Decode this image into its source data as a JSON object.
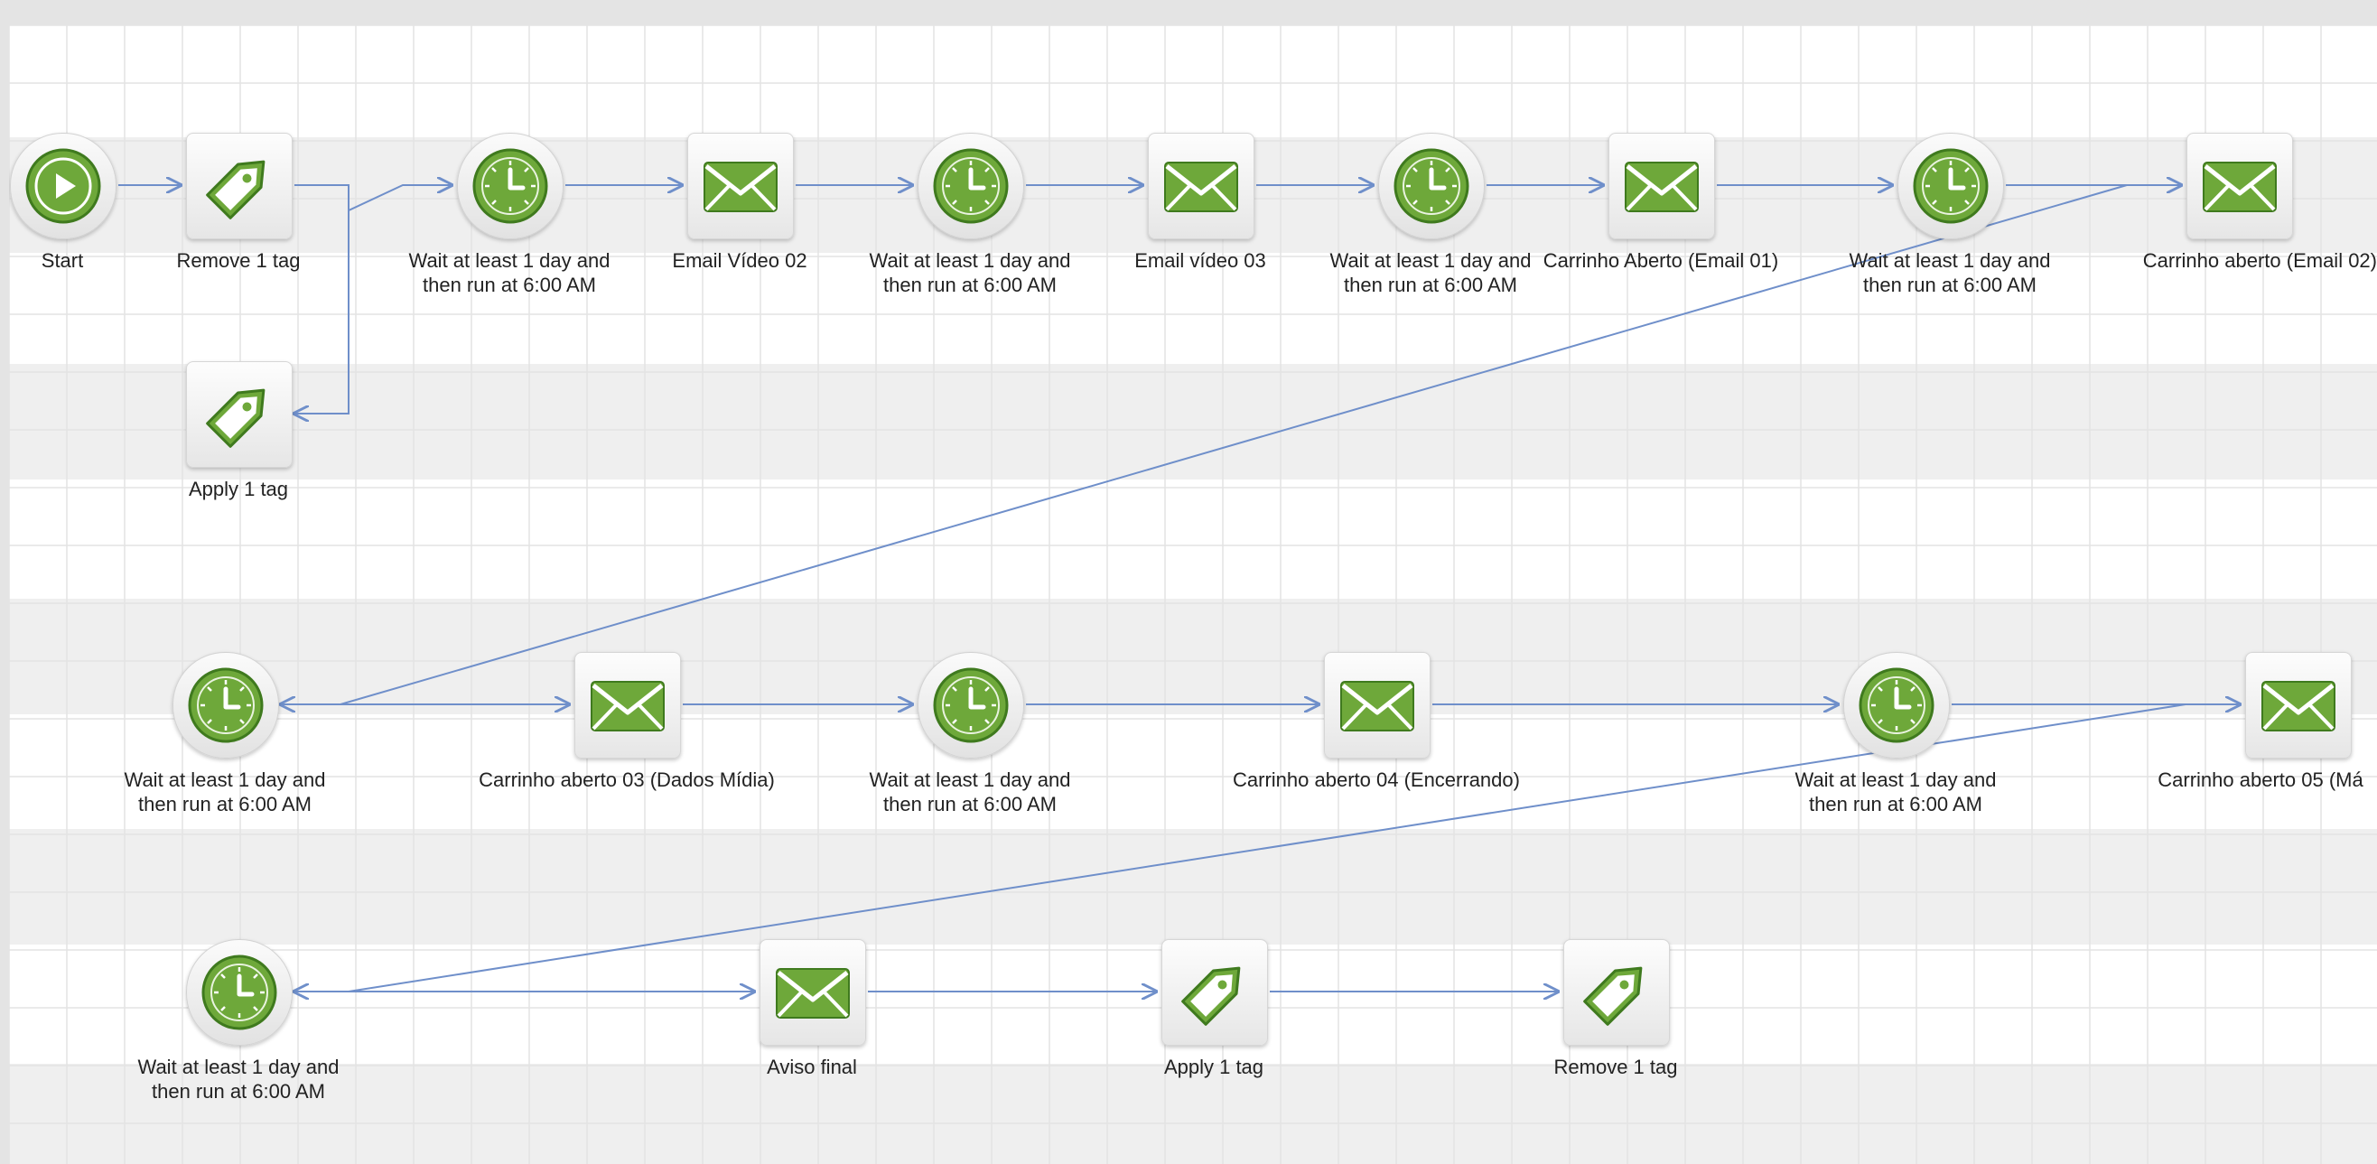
{
  "diagram": {
    "nodes": [
      {
        "id": "start",
        "kind": "start",
        "label": "Start"
      },
      {
        "id": "remove-tag-1",
        "kind": "tag",
        "label": "Remove 1 tag"
      },
      {
        "id": "apply-tag-1",
        "kind": "tag",
        "label": "Apply 1 tag"
      },
      {
        "id": "wait-1",
        "kind": "wait",
        "label": "Wait at least 1 day and\nthen run at 6:00 AM"
      },
      {
        "id": "email-video-02",
        "kind": "email",
        "label": "Email Vídeo 02"
      },
      {
        "id": "wait-2",
        "kind": "wait",
        "label": "Wait at least 1 day and\nthen run at 6:00 AM"
      },
      {
        "id": "email-video-03",
        "kind": "email",
        "label": "Email vídeo 03"
      },
      {
        "id": "wait-3",
        "kind": "wait",
        "label": "Wait at least 1 day and\nthen run at 6:00 AM"
      },
      {
        "id": "carrinho-01",
        "kind": "email",
        "label": "Carrinho Aberto (Email 01)"
      },
      {
        "id": "wait-4",
        "kind": "wait",
        "label": "Wait at least 1 day and\nthen run at 6:00 AM"
      },
      {
        "id": "carrinho-02",
        "kind": "email",
        "label": "Carrinho aberto (Email 02)"
      },
      {
        "id": "wait-5",
        "kind": "wait",
        "label": "Wait at least 1 day and\nthen run at 6:00 AM"
      },
      {
        "id": "carrinho-03",
        "kind": "email",
        "label": "Carrinho aberto 03 (Dados Mídia)"
      },
      {
        "id": "wait-6",
        "kind": "wait",
        "label": "Wait at least 1 day and\nthen run at 6:00 AM"
      },
      {
        "id": "carrinho-04",
        "kind": "email",
        "label": "Carrinho aberto 04 (Encerrando)"
      },
      {
        "id": "wait-7",
        "kind": "wait",
        "label": "Wait at least 1 day and\nthen run at 6:00 AM"
      },
      {
        "id": "carrinho-05",
        "kind": "email",
        "label": "Carrinho aberto 05 (Má"
      },
      {
        "id": "wait-8",
        "kind": "wait",
        "label": "Wait at least 1 day and\nthen run at 6:00 AM"
      },
      {
        "id": "aviso-final",
        "kind": "email",
        "label": "Aviso final"
      },
      {
        "id": "apply-tag-2",
        "kind": "tag",
        "label": "Apply 1 tag"
      },
      {
        "id": "remove-tag-2",
        "kind": "tag",
        "label": "Remove 1 tag"
      }
    ],
    "edges": [
      [
        "start",
        "remove-tag-1"
      ],
      [
        "remove-tag-1",
        "apply-tag-1"
      ],
      [
        "remove-tag-1",
        "wait-1"
      ],
      [
        "wait-1",
        "email-video-02"
      ],
      [
        "email-video-02",
        "wait-2"
      ],
      [
        "wait-2",
        "email-video-03"
      ],
      [
        "email-video-03",
        "wait-3"
      ],
      [
        "wait-3",
        "carrinho-01"
      ],
      [
        "carrinho-01",
        "wait-4"
      ],
      [
        "wait-4",
        "carrinho-02"
      ],
      [
        "carrinho-02",
        "wait-5"
      ],
      [
        "wait-5",
        "carrinho-03"
      ],
      [
        "carrinho-03",
        "wait-6"
      ],
      [
        "wait-6",
        "carrinho-04"
      ],
      [
        "carrinho-04",
        "wait-7"
      ],
      [
        "wait-7",
        "carrinho-05"
      ],
      [
        "carrinho-05",
        "wait-8"
      ],
      [
        "wait-8",
        "aviso-final"
      ],
      [
        "aviso-final",
        "apply-tag-2"
      ],
      [
        "apply-tag-2",
        "remove-tag-2"
      ]
    ]
  },
  "colors": {
    "connector": "#6f8fca",
    "icon_green": "#6ea83a",
    "icon_green_dark": "#3f7a1e",
    "grid_line": "#e3e3e3",
    "band": "#efefef"
  }
}
